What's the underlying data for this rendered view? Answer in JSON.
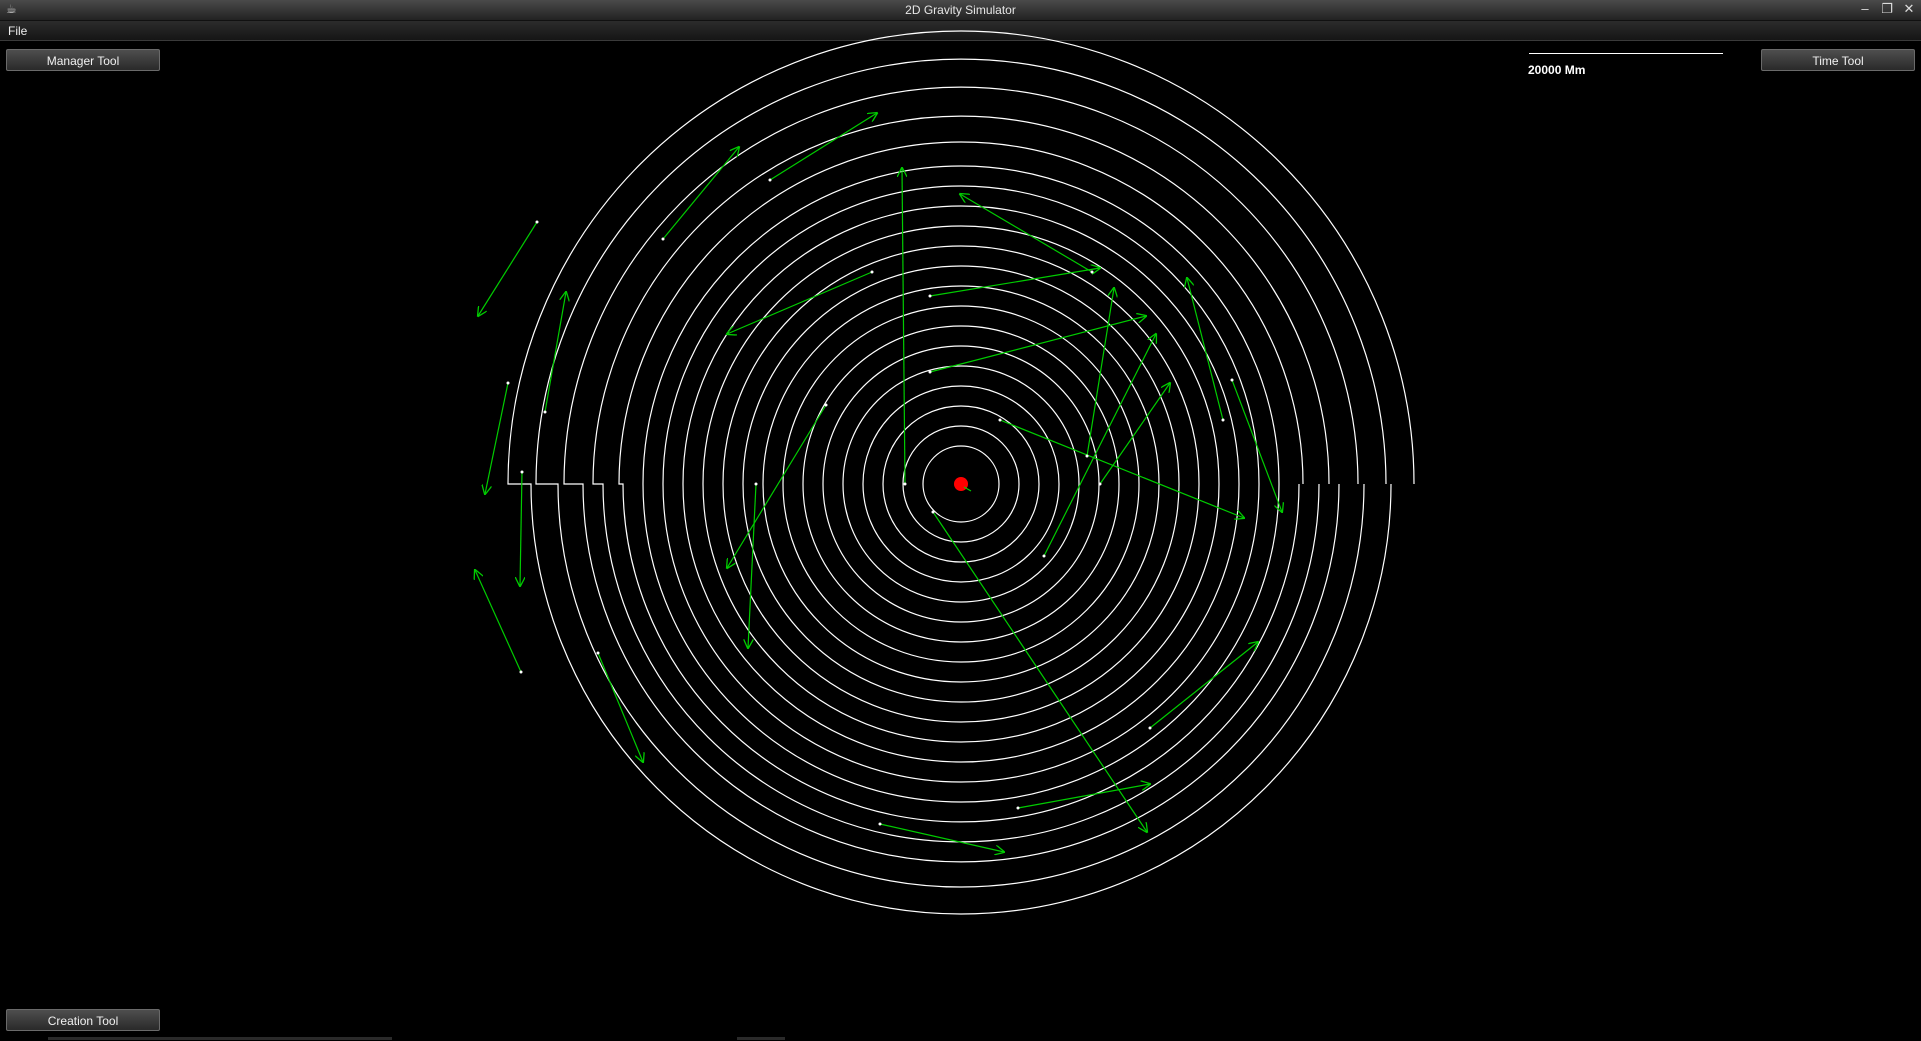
{
  "window": {
    "title": "2D Gravity Simulator",
    "app_icon": "app-cup-icon",
    "controls": [
      "minimize-icon",
      "maximize-icon",
      "close-icon"
    ]
  },
  "menu": {
    "items": [
      "File"
    ]
  },
  "toolbar": {
    "manager_tool": "Manager Tool",
    "time_tool": "Time Tool",
    "creation_tool": "Creation Tool"
  },
  "scale_bar": {
    "label": "20000 Mm"
  },
  "colors": {
    "background": "#000000",
    "orbit": "#ffffff",
    "velocity_vector": "#00cc00",
    "central_body": "#ff0000"
  }
}
